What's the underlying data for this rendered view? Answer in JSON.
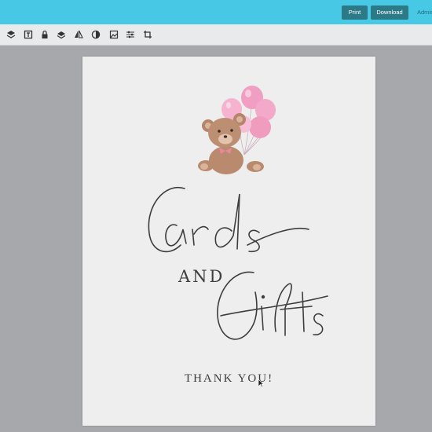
{
  "header": {
    "print_label": "Print",
    "download_label": "Download",
    "admin_label": "Admin"
  },
  "toolbar": {
    "tools": [
      "layers-icon",
      "text-icon",
      "lock-icon",
      "stack-icon",
      "flip-icon",
      "fill-icon",
      "image-icon",
      "adjust-icon",
      "crop-icon"
    ]
  },
  "document": {
    "title_word_1": "Cards",
    "connector": "AND",
    "title_word_2": "Gifts",
    "footer": "THANK YOU!"
  },
  "colors": {
    "topbar": "#47c8e4",
    "button": "#2c7a88",
    "toolbar": "#e9eaeb",
    "canvas_bg": "#a6a8ab",
    "page": "#eeeeee",
    "ink": "#3d3d3d",
    "balloon": "#f2a6c6",
    "bear": "#b98a6e"
  }
}
